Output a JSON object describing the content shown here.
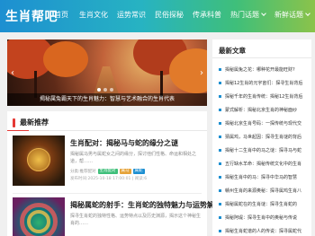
{
  "header": {
    "logo": "生肖帮吧",
    "nav": [
      "首页",
      "生肖文化",
      "运势常识",
      "民俗探秘",
      "传承科普",
      "热门话题",
      "新鲜话题"
    ]
  },
  "slider": {
    "caption": "揭秘属兔霸天下的生肖魅力：智慧与艺术融合的生肖代表",
    "arrow_left": "‹",
    "arrow_right": "›"
  },
  "recommend": {
    "title": "最新推荐",
    "cards": [
      {
        "title": "生肖配对：揭秘马与蛇的缘分之谜",
        "desc": "揭秘属马男与属蛇女之间的缘分，探讨他们性格、命运和相处之道，帮……",
        "meta_prefix": "分类:推荐配对",
        "tags": [
          "生肖配对",
          "属马",
          "属蛇"
        ],
        "date": "发布时间:2025-10-18 17:00:01 | 阅读:6"
      },
      {
        "title": "揭秘属蛇的射手：生肖蛇的独特魅力与运势解析",
        "desc": "探寻生肖蛇的独特性格、运势特点以及历史渊源，揭示这个神秘生肖的……",
        "meta_prefix": "",
        "tags": [],
        "date": ""
      }
    ]
  },
  "sidebar": {
    "title": "最新文章",
    "items": [
      "揭秘属兔之花：哪种花开最能旺财?",
      "揭秘12生肖的元宇宙们：探寻生肖背后",
      "探秘千年的生肖传统：揭秘12生肖背后",
      "蒙式解析：揭秘北京生肖的神秘面纱",
      "揭秘北京生肖号码：一探传统与现代交",
      "猜属鸡，马世起因：探寻生肖谜的背后",
      "揭秘十二生肖中的马之谜：探寻马与蛇",
      "五行缺水羊命：揭秘传统文化中的生肖",
      "揭秘生肖中的马：探寻中华马的智慧",
      "赣州生肖的来源奥秘：探寻属鸡生肖八",
      "揭秘属蛇在的生肖谜：探寻生肖蛇的",
      "揭秘阿堤：探寻生肖中的奥秘与传说",
      "揭秘生肖蛇谱的人的传说：探寻属蛇代"
    ]
  }
}
